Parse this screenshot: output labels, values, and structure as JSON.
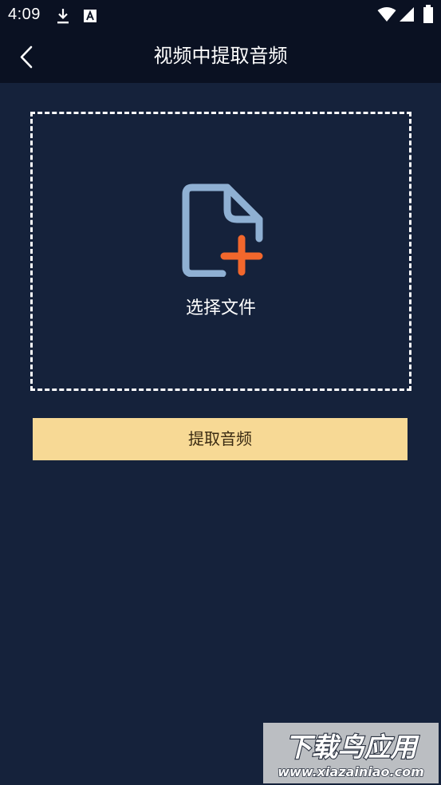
{
  "status_bar": {
    "time": "4:09",
    "icons": [
      "download-icon",
      "a-icon",
      "wifi-icon",
      "signal-icon",
      "battery-icon"
    ]
  },
  "header": {
    "title": "视频中提取音频",
    "back_icon": "chevron-left-icon"
  },
  "drop_zone": {
    "icon": "file-add-icon",
    "label": "选择文件"
  },
  "actions": {
    "extract_label": "提取音频"
  },
  "watermark": {
    "title": "下载鸟应用",
    "url": "www.xiazainiao.com"
  },
  "colors": {
    "background": "#15223b",
    "header": "#0a1122",
    "button": "#f7d995",
    "icon_file": "#8fb0d3",
    "icon_plus": "#f2672c"
  }
}
